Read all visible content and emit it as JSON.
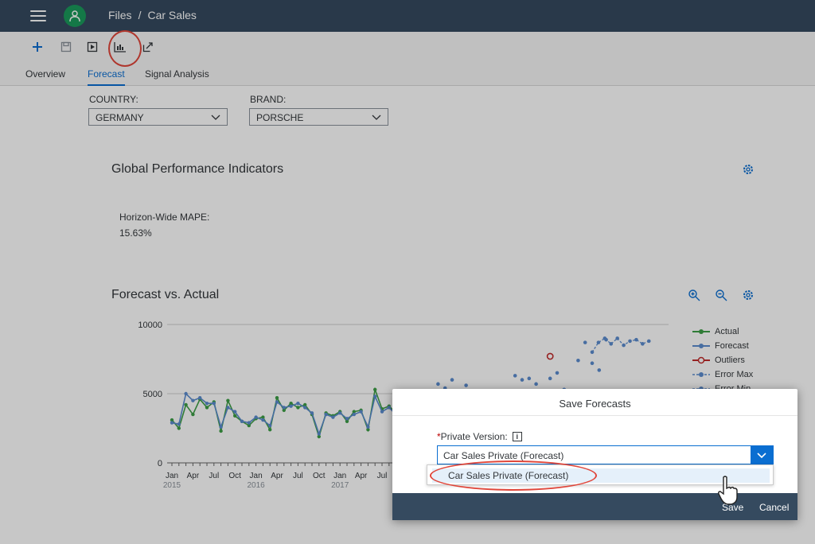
{
  "shell": {
    "breadcrumb": [
      "Files",
      "/",
      "Car Sales"
    ]
  },
  "toolbar": {
    "icons": [
      "add-icon",
      "save-icon",
      "play-icon",
      "save-forecast-icon",
      "share-icon"
    ]
  },
  "tabs": [
    {
      "label": "Overview",
      "active": false
    },
    {
      "label": "Forecast",
      "active": true
    },
    {
      "label": "Signal Analysis",
      "active": false
    }
  ],
  "filters": {
    "country": {
      "label": "COUNTRY:",
      "value": "GERMANY"
    },
    "brand": {
      "label": "BRAND:",
      "value": "PORSCHE"
    }
  },
  "kpi": {
    "title": "Global Performance Indicators",
    "metric_label": "Horizon-Wide MAPE:",
    "metric_value": "15.63%"
  },
  "forecast_card": {
    "title": "Forecast vs. Actual"
  },
  "chart_data": {
    "type": "line",
    "y_ticks": [
      "10000",
      "5000",
      "0"
    ],
    "ylim": [
      0,
      10000
    ],
    "month_labels": [
      "Jan",
      "Apr",
      "Jul",
      "Oct",
      "Jan",
      "Apr",
      "Jul",
      "Oct",
      "Jan",
      "Apr",
      "Jul"
    ],
    "year_labels": [
      "2015",
      "2016",
      "2017"
    ],
    "legend": [
      "Actual",
      "Forecast",
      "Outliers",
      "Error Max",
      "Error Min"
    ],
    "colors": {
      "actual": "#3d9e46",
      "forecast": "#5b8ccf",
      "outlier": "#c02b2b"
    },
    "series": [
      {
        "name": "Actual",
        "values": [
          3100,
          2500,
          4200,
          3500,
          4600,
          4000,
          4400,
          2300,
          4500,
          3400,
          3000,
          2700,
          3200,
          3300,
          2400,
          4700,
          3800,
          4300,
          4000,
          4200,
          3500,
          1900,
          3600,
          3400,
          3700,
          3000,
          3700,
          3800,
          2400,
          5300,
          3900,
          4100,
          3600,
          4400,
          1900,
          2600
        ]
      },
      {
        "name": "Forecast",
        "values": [
          2900,
          2800,
          5000,
          4500,
          4700,
          4300,
          4300,
          2600,
          4000,
          3700,
          3000,
          2900,
          3300,
          3100,
          2700,
          4400,
          4000,
          4100,
          4300,
          4000,
          3600,
          2100,
          3500,
          3300,
          3600,
          3200,
          3500,
          3700,
          2600,
          4800,
          3700,
          4000,
          3500,
          4200,
          2200,
          2700
        ]
      }
    ],
    "background_points": [
      {
        "i": 38,
        "v": 5700
      },
      {
        "i": 39,
        "v": 5400
      },
      {
        "i": 40,
        "v": 6000
      },
      {
        "i": 42,
        "v": 5600
      },
      {
        "i": 49,
        "v": 6300
      },
      {
        "i": 50,
        "v": 6000
      },
      {
        "i": 51,
        "v": 6100
      },
      {
        "i": 52,
        "v": 5700
      },
      {
        "i": 54,
        "v": 6100
      },
      {
        "i": 55,
        "v": 6500
      },
      {
        "i": 56,
        "v": 5300
      },
      {
        "i": 58,
        "v": 7400
      },
      {
        "i": 59,
        "v": 8700
      },
      {
        "i": 60,
        "v": 7200
      },
      {
        "i": 61,
        "v": 6700
      },
      {
        "i": 62,
        "v": 8900
      }
    ],
    "error_max": [
      8000,
      8700,
      9000,
      8600,
      9000,
      8500,
      8800,
      8900,
      8600,
      8800
    ]
  },
  "dialog": {
    "title": "Save Forecasts",
    "field_label": "Private Version:",
    "required_mark": "*",
    "info_mark": "i",
    "input_value": "Car Sales Private (Forecast)",
    "option": "Car Sales Private (Forecast)",
    "save_label": "Save",
    "cancel_label": "Cancel"
  }
}
